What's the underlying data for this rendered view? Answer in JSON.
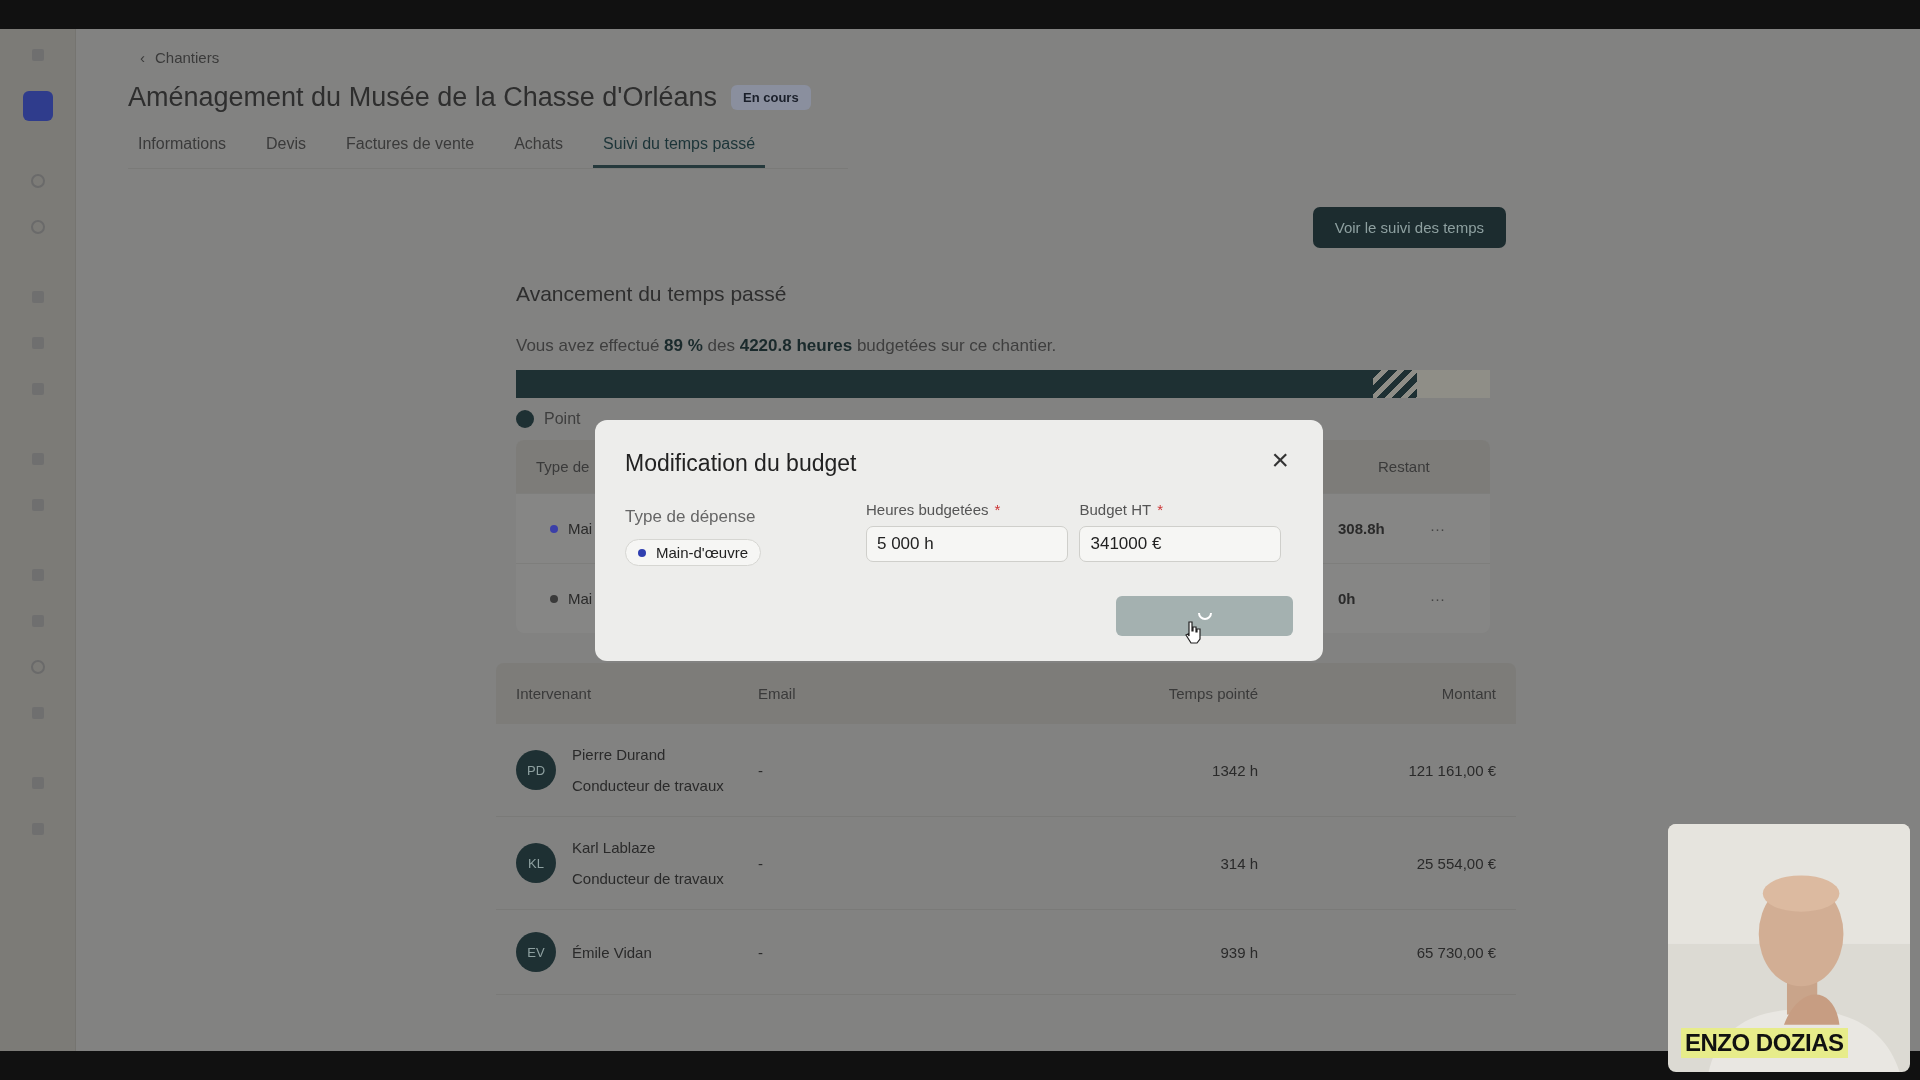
{
  "breadcrumb": {
    "icon": "‹",
    "label": "Chantiers"
  },
  "page": {
    "title": "Aménagement du Musée de la Chasse d'Orléans",
    "status": "En cours"
  },
  "tabs": [
    {
      "label": "Informations",
      "selected": false
    },
    {
      "label": "Devis",
      "selected": false
    },
    {
      "label": "Factures de vente",
      "selected": false
    },
    {
      "label": "Achats",
      "selected": false
    },
    {
      "label": "Suivi du temps passé",
      "selected": true
    }
  ],
  "action_button": "Voir le suivi des temps",
  "progress": {
    "title": "Avancement du temps passé",
    "sentence": "Vous avez effectué **89 %** des **4220.8 heures** budgetées sur ce chantier.",
    "level": 0.88,
    "legend": "Point"
  },
  "budget_table": {
    "columns": [
      "Type de",
      "Restant"
    ],
    "rows": [
      {
        "label": "Mai",
        "color": "#3b3fa8",
        "remaining": "308.8h",
        "menu": "···"
      },
      {
        "label": "Mai",
        "color": "#3a3a3a",
        "remaining": "0h",
        "menu": "···"
      }
    ]
  },
  "people_table": {
    "columns": [
      "Intervenant",
      "Email",
      "Temps pointé",
      "Montant"
    ],
    "rows": [
      {
        "initials": "PD",
        "name": "Pierre Durand",
        "role": "Conducteur de travaux",
        "email": "-",
        "time": "1342 h",
        "amount": "121 161,00 €"
      },
      {
        "initials": "KL",
        "name": "Karl Lablaze",
        "role": "Conducteur de travaux",
        "email": "-",
        "time": "314 h",
        "amount": "25 554,00 €"
      },
      {
        "initials": "EV",
        "name": "Émile Vidan",
        "email": "-",
        "time": "939 h",
        "amount": "65 730,00 €"
      }
    ]
  },
  "modal": {
    "title": "Modification du budget",
    "close": "×",
    "expense_label": "Type de dépense",
    "expense": {
      "label": "Main-d'œuvre",
      "color": "#2f3fb0"
    },
    "fields": [
      {
        "label": "Heures budgetées",
        "mark": "*",
        "value": "5 000 h"
      },
      {
        "label": "Budget HT",
        "mark": "*",
        "value": "341000 €"
      }
    ],
    "submit": {
      "loading": true
    }
  },
  "webcam": {
    "kind": "picture",
    "caption": "ENZO DOZIAS"
  }
}
